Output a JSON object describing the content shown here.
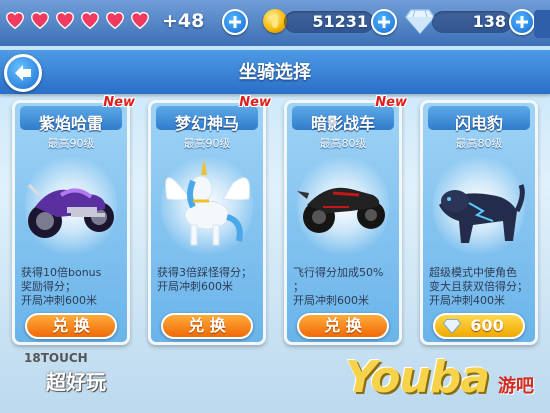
{
  "status_bar": {
    "lives_count": "+48",
    "coins": "51231",
    "gems": "138",
    "hearts_filled": 6
  },
  "header": {
    "title": "坐骑选择"
  },
  "cards": [
    {
      "name": "紫焰哈雷",
      "new_badge": "New",
      "max_level": "最高90级",
      "desc": [
        "获得10倍bonus",
        "奖励得分；",
        "开局冲刺600米"
      ],
      "button": "兑 换"
    },
    {
      "name": "梦幻神马",
      "new_badge": "New",
      "max_level": "最高90级",
      "desc": [
        "获得3倍踩怪得分；",
        "开局冲刺600米"
      ],
      "button": "兑 换"
    },
    {
      "name": "暗影战车",
      "new_badge": "New",
      "max_level": "最高80级",
      "desc": [
        "飞行得分加成50%",
        "；",
        "开局冲刺600米"
      ],
      "button": "兑 换"
    },
    {
      "name": "闪电豹",
      "new_badge": "",
      "max_level": "最高80级",
      "desc": [
        "超级模式中使角色",
        "变大且获双倍得分；",
        "开局冲刺400米"
      ],
      "button": "600"
    }
  ],
  "watermarks": {
    "left_top": "18TOUCH",
    "left_bottom": "超好玩",
    "right_brand": "Youba",
    "right_cn": "游吧"
  },
  "colors": {
    "topbar": "#3c6fb5",
    "titlebar": "#2a6fc8",
    "card": "#6ab4ea",
    "button": "#ef6a06",
    "new_badge": "#e0201c"
  },
  "icons": [
    "heart-icon",
    "plus-icon",
    "coin-icon",
    "diamond-icon",
    "back-arrow-icon"
  ]
}
